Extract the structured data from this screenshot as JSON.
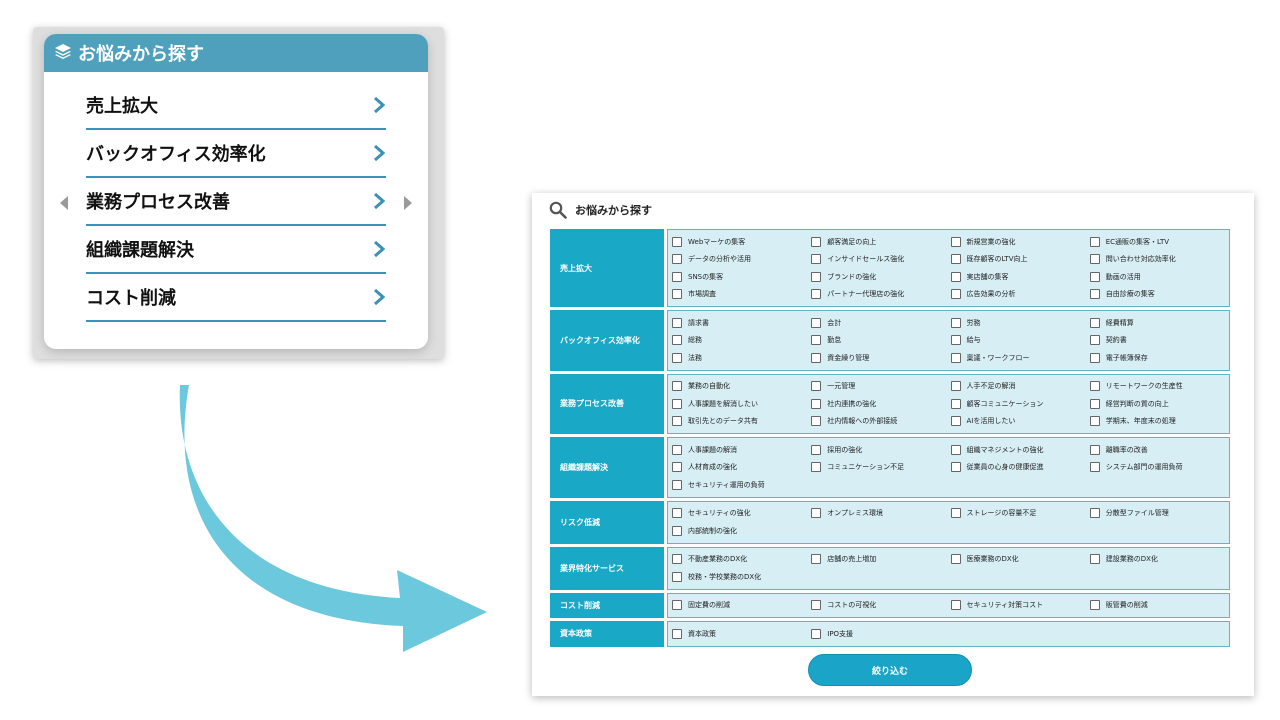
{
  "card": {
    "title": "お悩みから探す",
    "header_icon": "layers-icon",
    "items": [
      {
        "label": "売上拡大"
      },
      {
        "label": "バックオフィス効率化"
      },
      {
        "label": "業務プロセス改善"
      },
      {
        "label": "組織課題解決"
      },
      {
        "label": "コスト削減"
      }
    ]
  },
  "panel": {
    "title": "お悩みから探す",
    "search_icon": "search-icon",
    "button_label": "絞り込む",
    "categories": [
      {
        "label": "売上拡大",
        "options": [
          "Webマーケの集客",
          "顧客満足の向上",
          "新規営業の強化",
          "EC通販の集客・LTV",
          "データの分析や活用",
          "インサイドセールス強化",
          "既存顧客のLTV向上",
          "問い合わせ対応効率化",
          "SNSの集客",
          "ブランドの強化",
          "実店舗の集客",
          "動画の活用",
          "市場調査",
          "パートナー代理店の強化",
          "広告効果の分析",
          "自由診療の集客"
        ]
      },
      {
        "label": "バックオフィス効率化",
        "options": [
          "請求書",
          "会計",
          "労務",
          "経費精算",
          "総務",
          "勤怠",
          "給与",
          "契約書",
          "法務",
          "資金繰り管理",
          "稟議・ワークフロー",
          "電子帳簿保存"
        ]
      },
      {
        "label": "業務プロセス改善",
        "options": [
          "業務の自動化",
          "一元管理",
          "人手不足の解消",
          "リモートワークの生産性",
          "人事課題を解消したい",
          "社内連携の強化",
          "顧客コミュニケーション",
          "経営判断の質の向上",
          "取引先とのデータ共有",
          "社内情報への外部接続",
          "AIを活用したい",
          "学期末、年度末の処理"
        ]
      },
      {
        "label": "組織課題解決",
        "options": [
          "人事課題の解消",
          "採用の強化",
          "組織マネジメントの強化",
          "離職率の改善",
          "人材育成の強化",
          "コミュニケーション不足",
          "従業員の心身の健康促進",
          "システム部門の運用負荷",
          "セキュリティ運用の負荷"
        ]
      },
      {
        "label": "リスク低減",
        "options": [
          "セキュリティの強化",
          "オンプレミス環境",
          "ストレージの容量不足",
          "分散型ファイル管理",
          "内部統制の強化"
        ]
      },
      {
        "label": "業界特化サービス",
        "options": [
          "不動産業務のDX化",
          "店舗の売上増加",
          "医療業務のDX化",
          "建設業務のDX化",
          "校務・学校業務のDX化"
        ]
      },
      {
        "label": "コスト削減",
        "options": [
          "固定費の削減",
          "コストの可視化",
          "セキュリティ対策コスト",
          "販管費の削減"
        ]
      },
      {
        "label": "資本政策",
        "options": [
          "資本政策",
          "IPO支援"
        ]
      }
    ]
  },
  "colors": {
    "accent": "#19a8c6",
    "header": "#4ea0bd",
    "arrow": "#6cc8dc"
  }
}
